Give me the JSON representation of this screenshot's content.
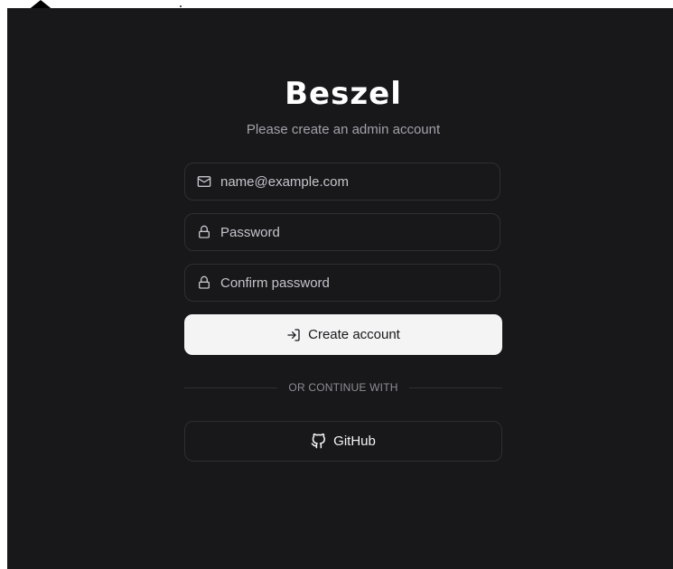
{
  "app": {
    "brand": "Beszel",
    "subtitle": "Please create an admin account"
  },
  "form": {
    "email": {
      "placeholder": "name@example.com",
      "value": "",
      "icon": "mail-icon"
    },
    "password": {
      "placeholder": "Password",
      "value": "",
      "icon": "lock-icon"
    },
    "confirm_password": {
      "placeholder": "Confirm password",
      "value": "",
      "icon": "lock-icon"
    },
    "submit": {
      "label": "Create account",
      "icon": "log-in-icon"
    }
  },
  "divider": {
    "label": "OR CONTINUE WITH"
  },
  "oauth": {
    "github": {
      "label": "GitHub",
      "icon": "github-icon"
    }
  },
  "colors": {
    "background": "#18181a",
    "text": "#ffffff",
    "muted": "#a1a1aa",
    "border": "#2f2f33",
    "primary_button": "#f4f4f5",
    "primary_text": "#18181b"
  }
}
